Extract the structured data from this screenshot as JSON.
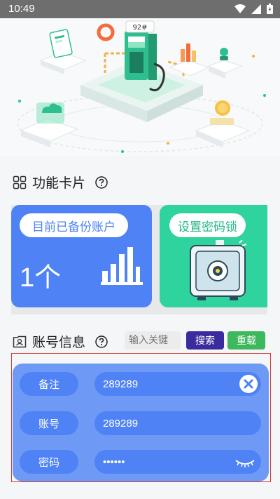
{
  "status_bar": {
    "time": "10:49"
  },
  "features": {
    "title": "功能卡片",
    "cards": [
      {
        "label": "目前已备份账户",
        "count": "1个"
      },
      {
        "label": "设置密码锁"
      }
    ]
  },
  "account": {
    "title": "账号信息",
    "search_placeholder": "输入关键",
    "search_label": "搜索",
    "reload_label": "重载",
    "rows": [
      {
        "label": "备注",
        "value": "289289"
      },
      {
        "label": "账号",
        "value": "289289"
      },
      {
        "label": "密码",
        "value": "••••••"
      }
    ]
  },
  "colors": {
    "primary": "#4f83f5",
    "green": "#2ed39d",
    "search": "#3b2c9e",
    "reload": "#3db85c",
    "frame": "#d53838"
  }
}
